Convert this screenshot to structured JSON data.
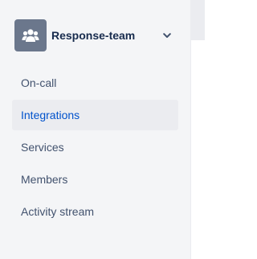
{
  "team": {
    "name": "Response-team",
    "avatar_icon": "team-people-icon",
    "menu_icon": "chevron-down-icon"
  },
  "nav": {
    "items": [
      {
        "label": "On-call",
        "active": false
      },
      {
        "label": "Integrations",
        "active": true
      },
      {
        "label": "Services",
        "active": false
      },
      {
        "label": "Members",
        "active": false
      },
      {
        "label": "Activity stream",
        "active": false
      }
    ]
  },
  "colors": {
    "sidebar_bg": "#f4f5f7",
    "active_bg": "#ebecf0",
    "active_text": "#0052cc",
    "text": "#42526e",
    "avatar_bg": "#6b778c"
  }
}
